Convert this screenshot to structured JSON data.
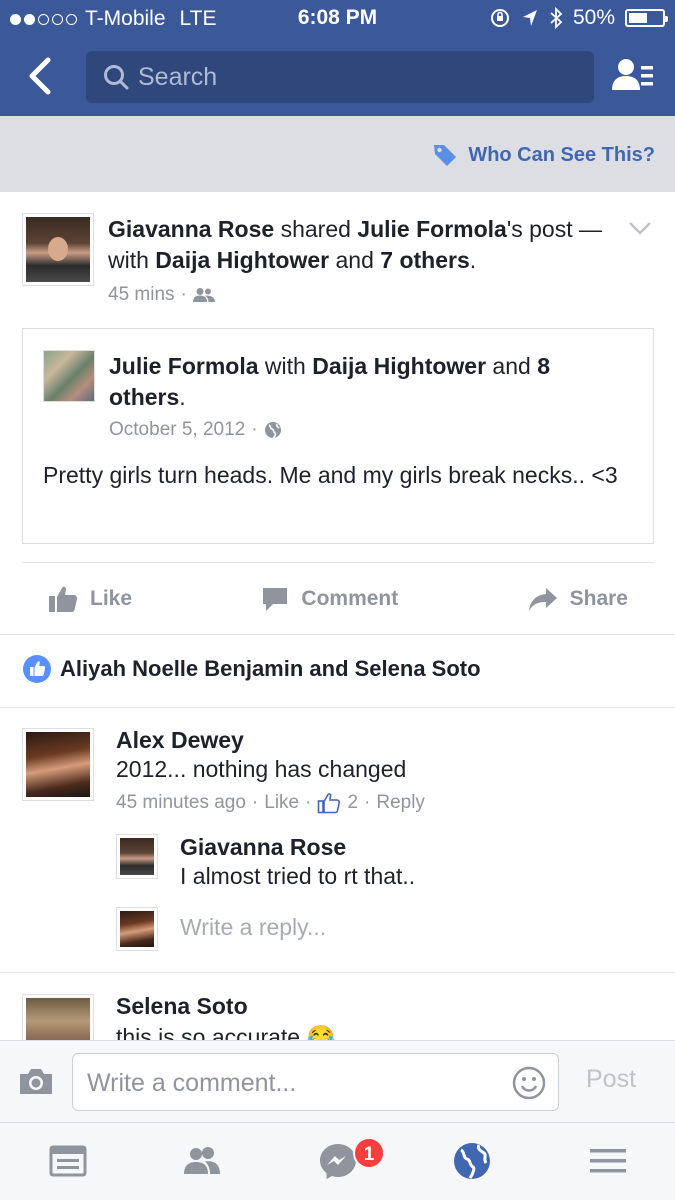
{
  "status_bar": {
    "carrier": "T-Mobile",
    "network": "LTE",
    "time": "6:08 PM",
    "battery": "50%",
    "battery_level": 0.5
  },
  "nav": {
    "search_placeholder": "Search"
  },
  "visibility": {
    "label": "Who Can See This?"
  },
  "post": {
    "author": "Giavanna Rose",
    "verb": " shared ",
    "original_author": "Julie Formola",
    "possessive": "'s",
    "post_word": " post — with ",
    "tagged": "Daija Hightower",
    "and_word": " and ",
    "others": "7 others",
    "period": ".",
    "time": "45 mins",
    "sep": "·"
  },
  "shared_post": {
    "author": "Julie Formola",
    "with_word": " with ",
    "tagged": "Daija Hightower",
    "and_word": " and ",
    "others": "8 others",
    "period": ".",
    "date": "October 5, 2012",
    "sep": "·",
    "text": "Pretty girls turn heads. Me and my girls break necks.. <3"
  },
  "actions": {
    "like": "Like",
    "comment": "Comment",
    "share": "Share"
  },
  "likes": {
    "text": "Aliyah Noelle Benjamin and Selena Soto"
  },
  "comments": [
    {
      "name": "Alex Dewey",
      "text": "2012... nothing has changed",
      "time": "45 minutes ago",
      "like": "Like",
      "like_count": "2",
      "reply": "Reply",
      "sep": "·"
    },
    {
      "name": "Giavanna Rose",
      "text": "I almost tried to rt that.."
    },
    {
      "name": "Selena Soto",
      "text": "this is so accurate 😂"
    }
  ],
  "reply_placeholder": "Write a reply...",
  "compose": {
    "placeholder": "Write a comment...",
    "post_label": "Post"
  },
  "tabbar": {
    "messenger_badge": "1"
  },
  "colors": {
    "brand": "#3b5998",
    "link": "#4267b2",
    "muted": "#90949c",
    "badge": "#fa3e3e"
  }
}
